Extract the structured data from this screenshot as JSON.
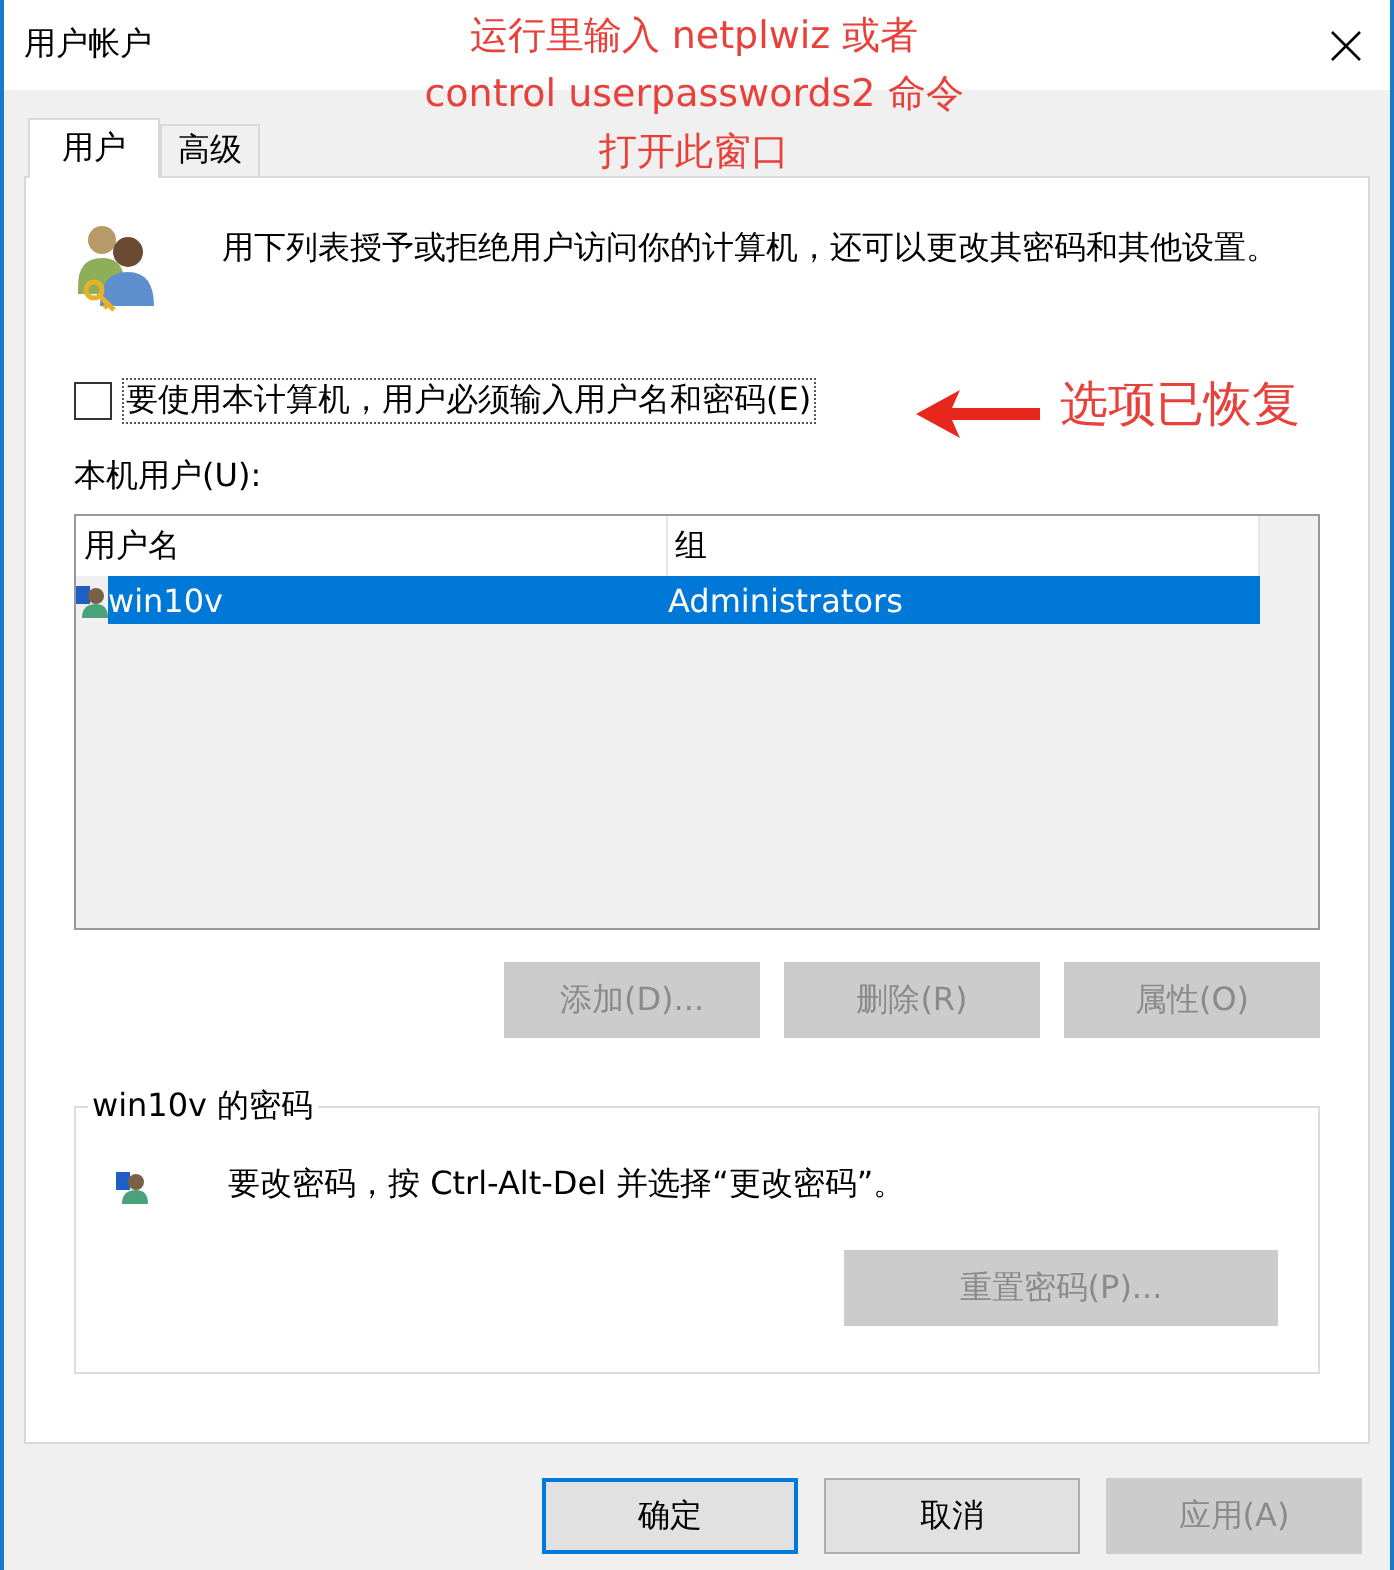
{
  "window": {
    "title": "用户帐户"
  },
  "annotations": {
    "top": [
      "运行里输入 netplwiz 或者",
      "control userpasswords2 命令",
      "打开此窗口"
    ],
    "option_note": "选项已恢复"
  },
  "tabs": [
    {
      "label": "用户",
      "selected": true
    },
    {
      "label": "高级",
      "selected": false
    }
  ],
  "intro": "用下列表授予或拒绝用户访问你的计算机，还可以更改其密码和其他设置。",
  "require_password": {
    "label": "要使用本计算机，用户必须输入用户名和密码(E)",
    "checked": false
  },
  "users_label": "本机用户(U):",
  "users_table": {
    "columns": [
      "用户名",
      "组"
    ],
    "rows": [
      {
        "cells": [
          "win10v",
          "Administrators"
        ],
        "selected": true
      }
    ]
  },
  "user_buttons": [
    {
      "label": "添加(D)...",
      "disabled": true
    },
    {
      "label": "删除(R)",
      "disabled": true
    },
    {
      "label": "属性(O)",
      "disabled": true
    }
  ],
  "password_group": {
    "title": "win10v 的密码",
    "note": "要改密码，按 Ctrl-Alt-Del 并选择“更改密码”。",
    "button": {
      "label": "重置密码(P)...",
      "disabled": true
    }
  },
  "dialog_buttons": [
    {
      "label": "确定",
      "default": true,
      "disabled": false
    },
    {
      "label": "取消",
      "default": false,
      "disabled": false
    },
    {
      "label": "应用(A)",
      "default": false,
      "disabled": true
    }
  ]
}
